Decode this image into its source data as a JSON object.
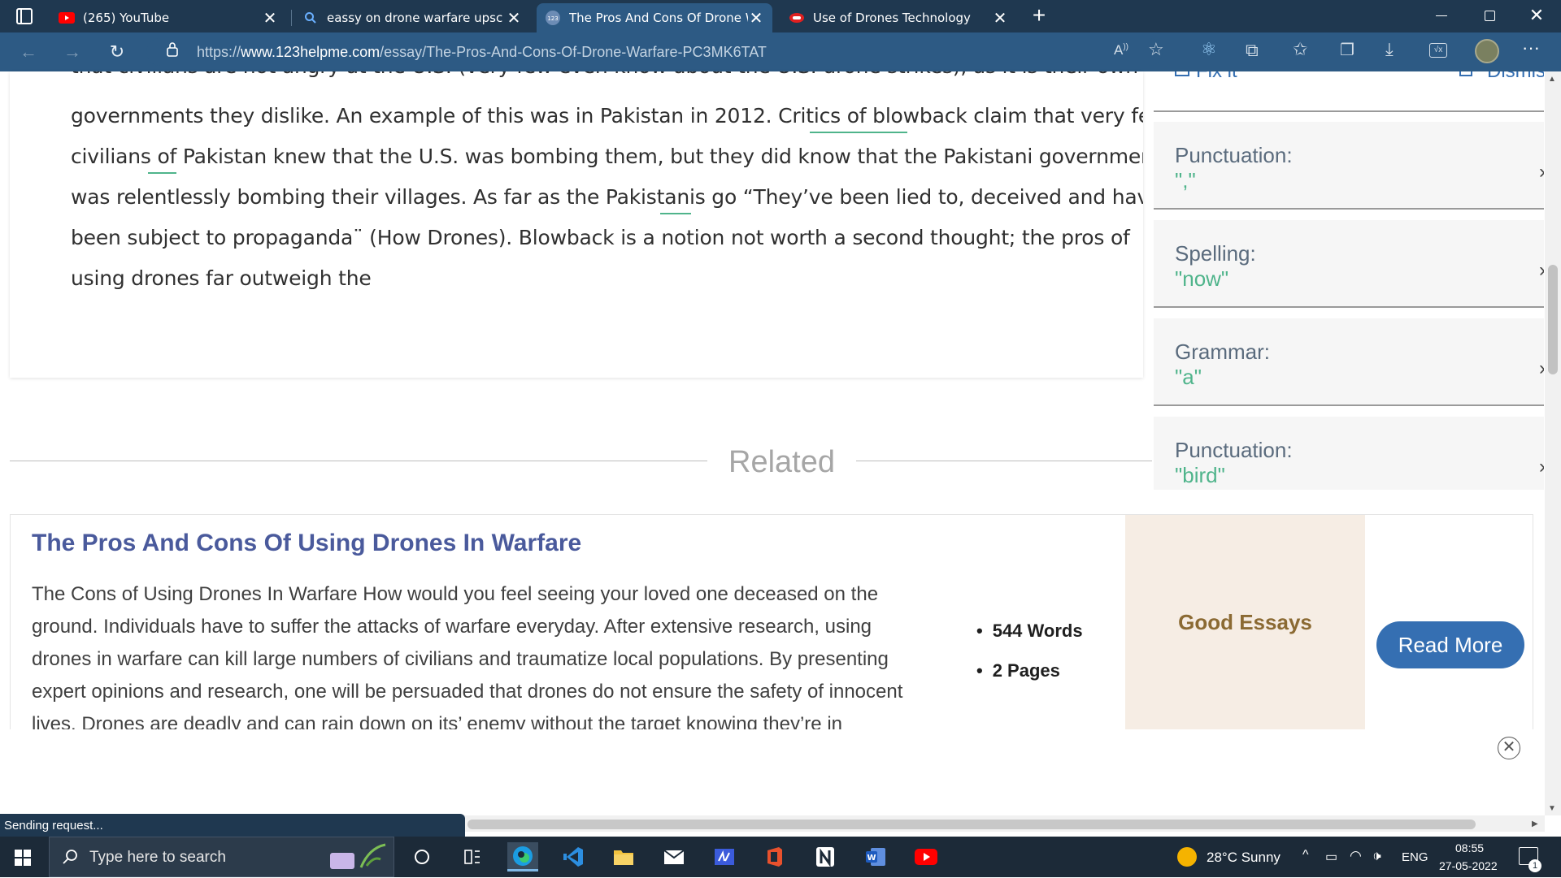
{
  "browser": {
    "tabs": [
      {
        "title": "(265) YouTube",
        "icon": "youtube-icon",
        "active": false
      },
      {
        "title": "eassy on drone warfare upsc - Bi",
        "icon": "search-icon",
        "active": false
      },
      {
        "title": "The Pros And Cons Of Drone Wa",
        "icon": "site-123-icon",
        "active": true
      },
      {
        "title": "Use of Drones Technology",
        "icon": "pdf-icon",
        "active": false
      }
    ],
    "url_prefix": "https://",
    "url_domain": "www.123helpme.com",
    "url_path": "/essay/The-Pros-And-Cons-Of-Drone-Warfare-PC3MK6TAT"
  },
  "article": {
    "lines": [
      "that civilians are not angry at the U.S. (very few even know about the U.S. drone strikes), as it is their own",
      "governments they dislike. An example of this was in Pakistan in 2012. Critics of blowback claim that very few",
      "civilians of Pakistan knew that the U.S. was bombing them, but they did know that the Pakistani government",
      "was relentlessly bombing their villages. As far as the Pakistanis go “They’ve been lied to, deceived and have",
      "been subject to propaganda¨ (How Drones). Blowback is a notion not worth a second thought; the pros of",
      "using drones far outweigh the"
    ]
  },
  "suggestions": {
    "top_fix": "Fix it",
    "top_dismiss": "Dismiss",
    "items": [
      {
        "type": "Punctuation:",
        "value": "\",\""
      },
      {
        "type": "Spelling:",
        "value": "\"now\""
      },
      {
        "type": "Grammar:",
        "value": "\"a\""
      },
      {
        "type": "Punctuation:",
        "value": "\"bird\""
      }
    ]
  },
  "related": {
    "heading": "Related",
    "card": {
      "title": "The Pros And Cons Of Using Drones In Warfare",
      "lines": [
        "The Cons of Using Drones In Warfare How would you feel seeing your loved one deceased on the",
        "ground. Individuals have to suffer the attacks of warfare everyday. After extensive research, using",
        "drones in warfare can kill large numbers of civilians and traumatize local populations. By presenting",
        "expert opinions and research, one will be persuaded that drones do not ensure the safety of innocent",
        "lives. Drones are deadly and can rain down on its’ enemy without the target knowing they’re in"
      ],
      "words": "544 Words",
      "pages": "2 Pages",
      "grade": "Good Essays",
      "read_more": "Read More"
    }
  },
  "status_text": "Sending request...",
  "taskbar": {
    "search_placeholder": "Type here to search",
    "weather": "28°C  Sunny",
    "language": "ENG",
    "time": "08:55",
    "date": "27-05-2022",
    "notification_count": "1"
  },
  "colors": {
    "chrome_dark": "#1f3850",
    "chrome_active": "#2d5a84",
    "suggestion_value": "#4fb48b",
    "related_title": "#4a5a9c",
    "read_more": "#356fb2",
    "grade_bg": "#f6ede4"
  }
}
